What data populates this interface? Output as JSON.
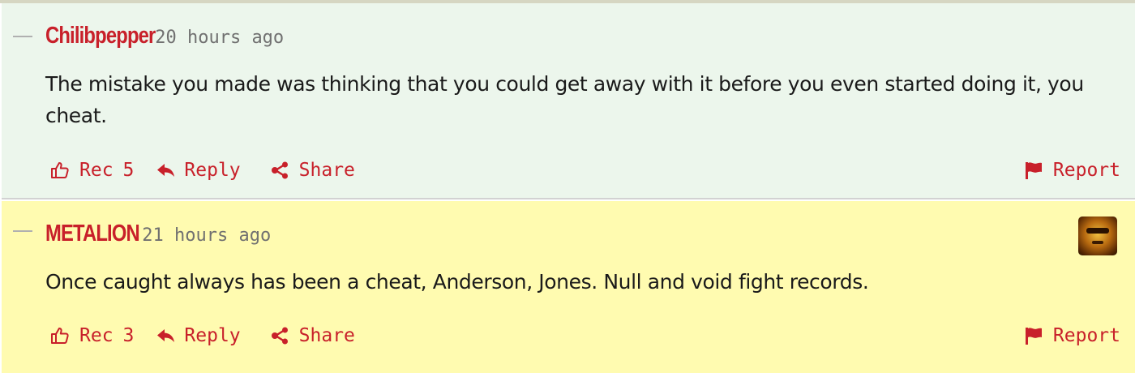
{
  "comments": [
    {
      "author": "Chilibpepper",
      "time": "20 hours ago",
      "text": "The mistake you made was thinking that you could get away with it before you even started doing it, you cheat.",
      "rec_label": "Rec",
      "rec_count": "5",
      "reply_label": "Reply",
      "share_label": "Share",
      "report_label": "Report"
    },
    {
      "author": "METALION",
      "time": "21 hours ago",
      "text": "Once caught always has been a cheat, Anderson, Jones. Null and void fight records.",
      "rec_label": "Rec",
      "rec_count": "3",
      "reply_label": "Reply",
      "share_label": "Share",
      "report_label": "Report"
    }
  ],
  "icons": {
    "rec": "thumbs-up-icon",
    "reply": "reply-arrow-icon",
    "share": "share-icon",
    "report": "flag-icon",
    "collapse": "collapse-line-icon"
  },
  "colors": {
    "accent": "#c8202a",
    "highlight_bg": "#fffbb0",
    "default_bg": "#ecf6ec"
  }
}
